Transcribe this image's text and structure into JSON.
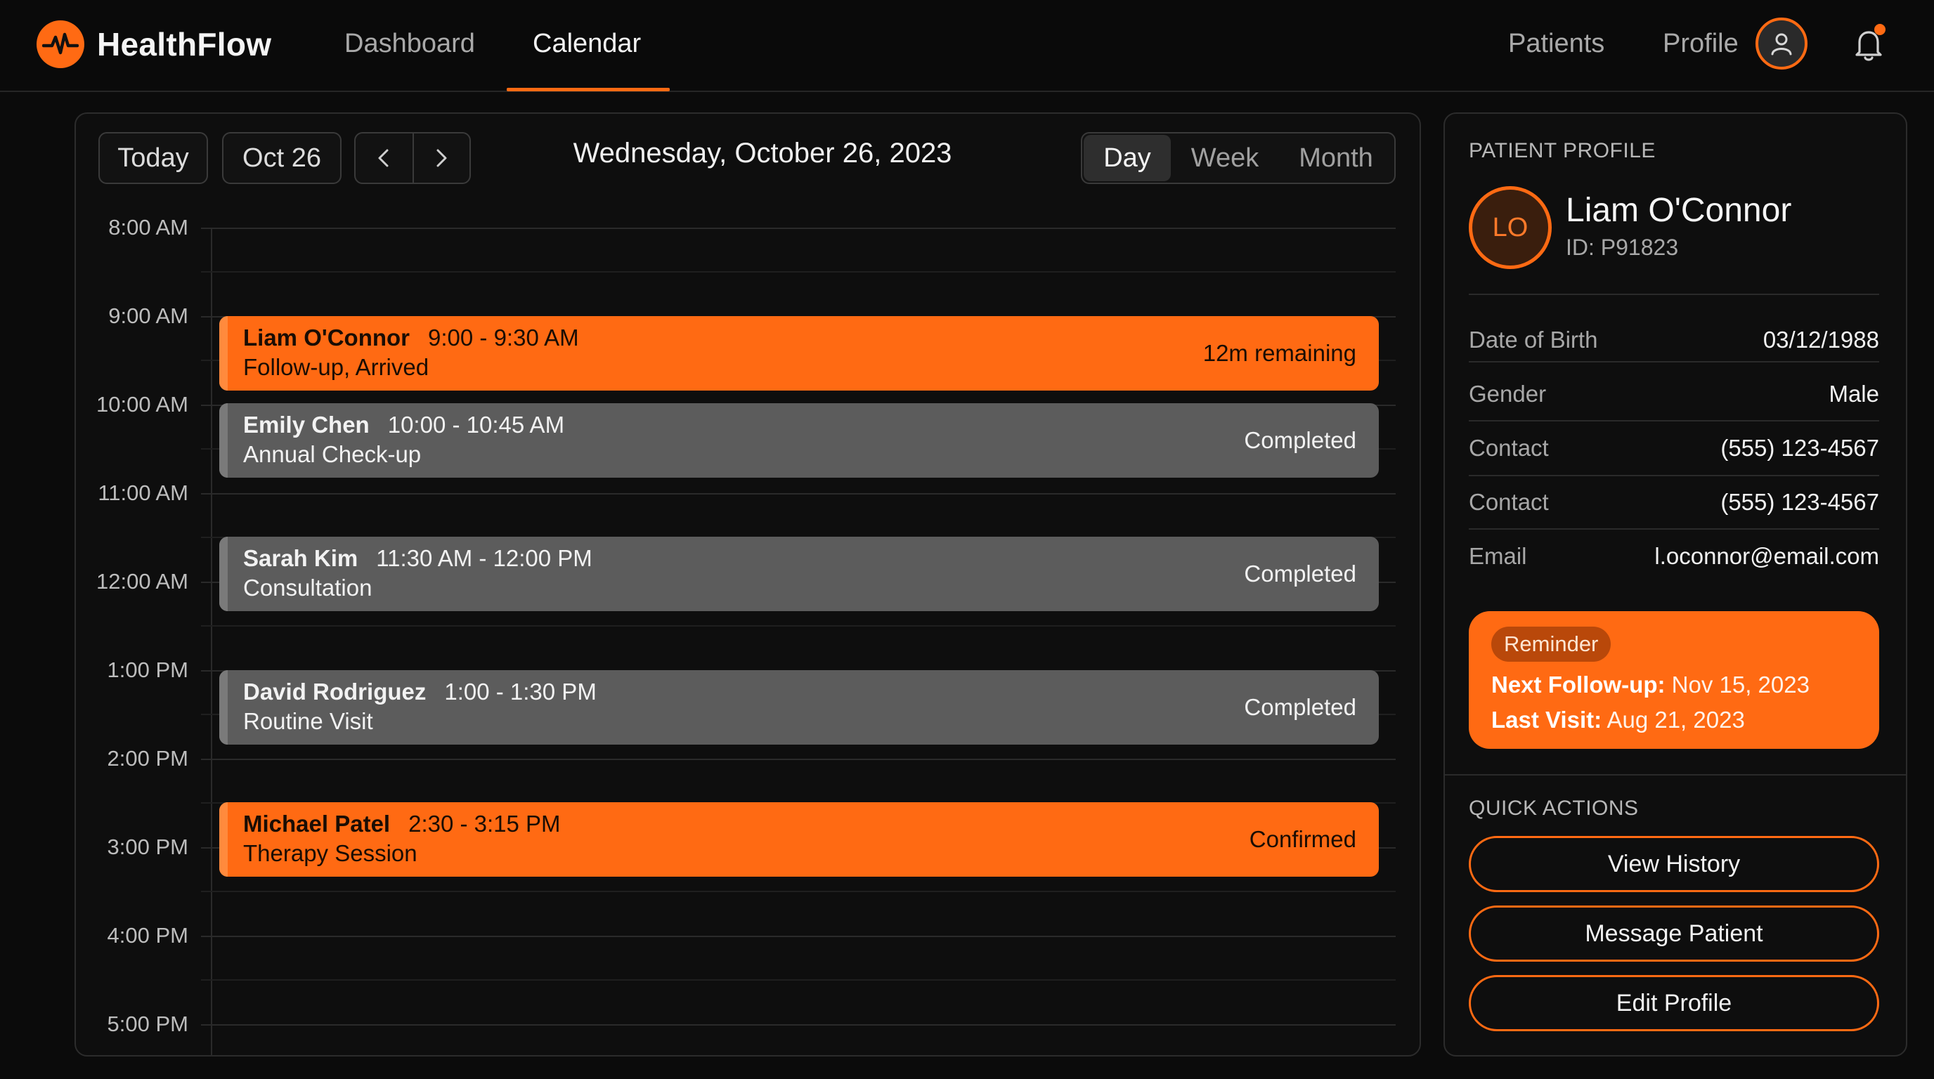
{
  "app": {
    "name": "HealthFlow",
    "accent": "#ff6a13"
  },
  "nav": {
    "left": [
      {
        "label": "Dashboard",
        "active": false
      },
      {
        "label": "Calendar",
        "active": true
      }
    ],
    "right": {
      "patients": "Patients",
      "profile": "Profile"
    },
    "icons": {
      "logo": "heartbeat-icon",
      "avatar": "user-icon",
      "notifications": "bell-icon"
    },
    "has_unread_notifications": true
  },
  "calendar": {
    "today_label": "Today",
    "date_chip": "Oct 26",
    "date_title": "Wednesday, October 26, 2023",
    "views": [
      "Day",
      "Week",
      "Month"
    ],
    "active_view": "Day",
    "hours": [
      "8:00 AM",
      "9:00 AM",
      "10:00 AM",
      "11:00 AM",
      "12:00 AM",
      "1:00 PM",
      "2:00 PM",
      "3:00 PM",
      "4:00 PM",
      "5:00 PM"
    ],
    "events": [
      {
        "name": "Liam O'Connor",
        "time": "9:00 - 9:30 AM",
        "detail": "Follow-up, Arrived",
        "status": "12m remaining",
        "style": "orange"
      },
      {
        "name": "Emily Chen",
        "time": "10:00 - 10:45 AM",
        "detail": "Annual Check-up",
        "status": "Completed",
        "style": "gray"
      },
      {
        "name": "Sarah Kim",
        "time": "11:30 AM - 12:00 PM",
        "detail": "Consultation",
        "status": "Completed",
        "style": "gray"
      },
      {
        "name": "David Rodriguez",
        "time": "1:00 - 1:30 PM",
        "detail": "Routine Visit",
        "status": "Completed",
        "style": "gray"
      },
      {
        "name": "Michael Patel",
        "time": "2:30 - 3:15 PM",
        "detail": "Therapy Session",
        "status": "Confirmed",
        "style": "orange"
      }
    ]
  },
  "profile": {
    "section_title": "PATIENT PROFILE",
    "initials": "LO",
    "name": "Liam O'Connor",
    "id": "ID: P91823",
    "fields": [
      {
        "label": "Date of Birth",
        "value": "03/12/1988"
      },
      {
        "label": "Gender",
        "value": "Male"
      },
      {
        "label": "Contact",
        "value": "(555) 123-4567"
      },
      {
        "label": "Contact",
        "value": "(555) 123-4567"
      },
      {
        "label": "Email",
        "value": "l.oconnor@email.com"
      }
    ],
    "reminder": {
      "badge": "Reminder",
      "next_label": "Next Follow-up:",
      "next_value": "Nov 15, 2023",
      "last_label": "Last Visit:",
      "last_value": "Aug 21, 2023"
    }
  },
  "quick_actions": {
    "title": "QUICK ACTIONS",
    "buttons": [
      "View History",
      "Message Patient",
      "Edit Profile"
    ]
  }
}
